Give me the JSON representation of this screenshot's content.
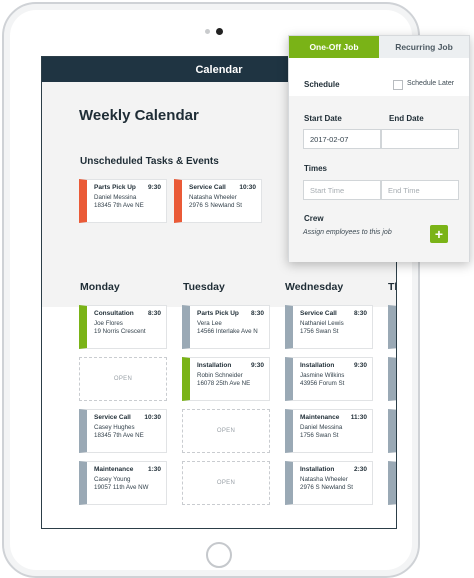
{
  "app": {
    "header_title": "Calendar",
    "page_title": "Weekly Calendar"
  },
  "unscheduled": {
    "title": "Unscheduled Tasks & Events",
    "cards": [
      {
        "title": "Parts Pick Up",
        "time": "9:30",
        "name": "Daniel Messina",
        "address": "18345 7th Ave NE",
        "status_color": "#ea5a37"
      },
      {
        "title": "Service Call",
        "time": "10:30",
        "name": "Natasha Wheeler",
        "address": "2976 S Newland St",
        "status_color": "#ea5a37"
      }
    ]
  },
  "days": [
    {
      "label": "Monday"
    },
    {
      "label": "Tuesday"
    },
    {
      "label": "Wednesday"
    },
    {
      "label": "Th"
    }
  ],
  "monday": [
    {
      "title": "Consultation",
      "time": "8:30",
      "name": "Joe Flores",
      "address": "19 Norris Crescent"
    },
    {
      "open": "OPEN"
    },
    {
      "title": "Service Call",
      "time": "10:30",
      "name": "Casey Hughes",
      "address": "18345 7th Ave NE"
    },
    {
      "title": "Maintenance",
      "time": "1:30",
      "name": "Casey Young",
      "address": "19057 11th Ave NW"
    }
  ],
  "tuesday": [
    {
      "title": "Parts Pick Up",
      "time": "8:30",
      "name": "Vera Lee",
      "address": "14566 Interlake Ave N"
    },
    {
      "title": "Installation",
      "time": "9:30",
      "name": "Robin Schneider",
      "address": "16078 25th Ave NE"
    },
    {
      "open": "OPEN"
    },
    {
      "open": "OPEN"
    }
  ],
  "wednesday": [
    {
      "title": "Service Call",
      "time": "8:30",
      "name": "Nathaniel Lewis",
      "address": "1756 Swan St"
    },
    {
      "title": "Installation",
      "time": "9:30",
      "name": "Jasmine Wilkins",
      "address": "43956 Forum St"
    },
    {
      "title": "Maintenance",
      "time": "11:30",
      "name": "Daniel Messina",
      "address": "1756 Swan St"
    },
    {
      "title": "Installation",
      "time": "2:30",
      "name": "Natasha Wheeler",
      "address": "2976 S Newland St"
    }
  ],
  "popup": {
    "tab_one_off": "One-Off Job",
    "tab_recurring": "Recurring Job",
    "schedule_label": "Schedule",
    "schedule_later_label": "Schedule Later",
    "start_date_label": "Start Date",
    "end_date_label": "End Date",
    "start_date_value": "2017-02-07",
    "times_label": "Times",
    "start_time_placeholder": "Start Time",
    "end_time_placeholder": "End Time",
    "crew_label": "Crew",
    "crew_hint": "Assign employees to this job",
    "add_icon": "plus-icon"
  },
  "colors": {
    "header": "#1f3442",
    "accent_green": "#7ab317",
    "accent_red": "#ea5a37",
    "neutral_bar": "#9aa9b5"
  }
}
